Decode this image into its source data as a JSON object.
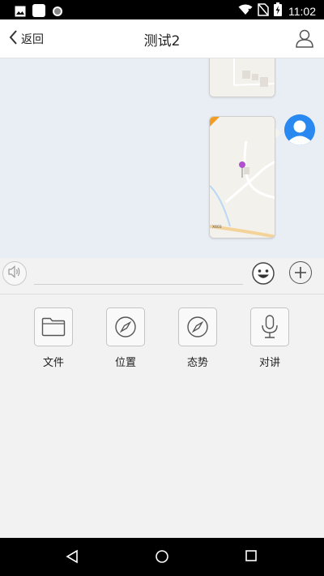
{
  "status_bar": {
    "time": "11:02",
    "icons": [
      "image-icon",
      "square-icon",
      "circle-icon",
      "wifi-icon",
      "no-sim-icon",
      "battery-charging-icon"
    ]
  },
  "header": {
    "back_label": "返回",
    "title": "测试2",
    "user_icon": "user-icon"
  },
  "chat": {
    "map_label": "X603"
  },
  "input_bar": {
    "text_value": "",
    "voice_icon": "speaker-icon",
    "emoji_icon": "emoji-icon",
    "plus_icon": "plus-icon"
  },
  "functions": [
    {
      "label": "文件",
      "icon": "folder-icon"
    },
    {
      "label": "位置",
      "icon": "compass-icon"
    },
    {
      "label": "态势",
      "icon": "compass-icon"
    },
    {
      "label": "对讲",
      "icon": "microphone-icon"
    }
  ],
  "nav_bar": {
    "icons": [
      "back-triangle-icon",
      "home-circle-icon",
      "recents-square-icon"
    ]
  },
  "colors": {
    "accent": "#2a89f0",
    "pin": "#b050d0"
  }
}
